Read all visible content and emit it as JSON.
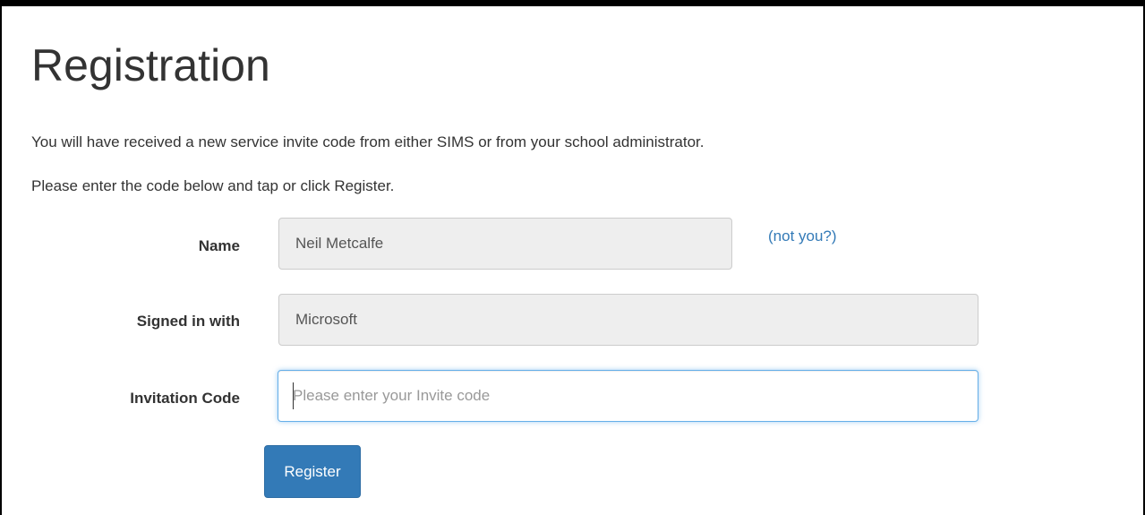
{
  "page": {
    "title": "Registration",
    "intro_line_1": "You will have received a new service invite code from either SIMS or from your school administrator.",
    "intro_line_2": "Please enter the code below and tap or click Register."
  },
  "form": {
    "name": {
      "label": "Name",
      "value": "Neil Metcalfe",
      "not_you_link": "(not you?)"
    },
    "signed_in_with": {
      "label": "Signed in with",
      "value": "Microsoft"
    },
    "invitation_code": {
      "label": "Invitation Code",
      "value": "",
      "placeholder": "Please enter your Invite code"
    },
    "register_label": "Register"
  },
  "colors": {
    "primary": "#337ab7",
    "focus_border": "#66afe9",
    "readonly_bg": "#eeeeee",
    "text": "#333333"
  }
}
